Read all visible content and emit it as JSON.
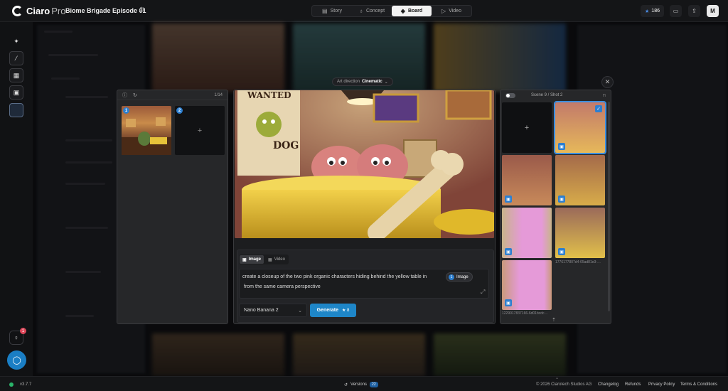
{
  "header": {
    "logo_text": "Ciaro",
    "logo_suffix": "Pro",
    "project_title": "Biome Brigade Episode 01",
    "tabs": [
      {
        "label": "Story",
        "icon": "doc-icon",
        "active": false
      },
      {
        "label": "Concept",
        "icon": "bulb-icon",
        "active": false
      },
      {
        "label": "Board",
        "icon": "board-icon",
        "active": true
      },
      {
        "label": "Video",
        "icon": "play-icon",
        "active": false
      }
    ],
    "credits": "186",
    "avatar_initial": "M"
  },
  "art_direction": {
    "label": "Art direction",
    "value": "Cinematic"
  },
  "reference_panel": {
    "count": "1/14",
    "slot_numbers": [
      "1",
      "2"
    ]
  },
  "prompt": {
    "mode_tabs": [
      "Image",
      "Video"
    ],
    "active_mode": "Image",
    "text_line1": "create a closeup of the two pink organic characters hiding behind the yellow table in",
    "chip_label": "Image",
    "chip_number": "1",
    "text_line2": "from the same camera perspective",
    "model": "Nano Banana 2",
    "generate_label": "Generate",
    "generate_cost": "8"
  },
  "shots_panel": {
    "title": "Scene 9 / Shot 2",
    "file_names": [
      "1776177807d4-65ad81e3-…",
      "1229017837166-6d01bcdc…"
    ]
  },
  "scene_image": {
    "sign_top": "WANTED",
    "sign_bottom": "DOG"
  },
  "footer": {
    "version": "v3.7.7",
    "versions_label": "Versions",
    "versions_count": "22",
    "copyright": "© 2026 Ciarotech Studios AG",
    "links": [
      "Changelog",
      "Refunds",
      "Privacy Policy",
      "Terms & Conditions"
    ]
  },
  "colors": {
    "accent": "#1e86c8",
    "badge": "#2d7fd0",
    "status_green": "#2ab46a",
    "notification": "#e0485b"
  },
  "notification_count": "1"
}
